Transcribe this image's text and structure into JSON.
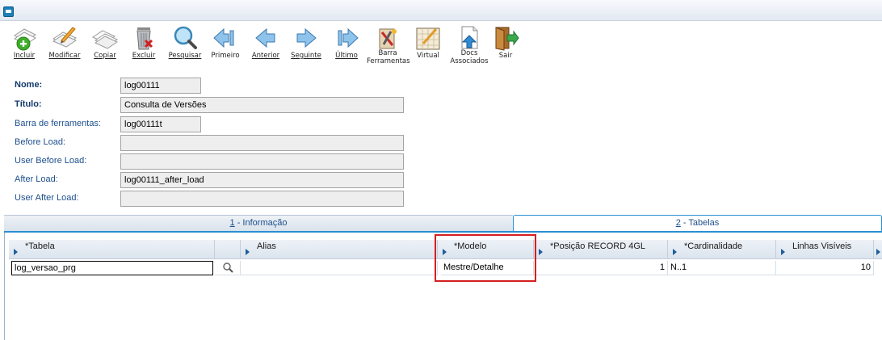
{
  "toolbar": {
    "items": [
      {
        "label": "Incluir",
        "icon": "add-document-icon"
      },
      {
        "label": "Modificar",
        "icon": "edit-document-icon"
      },
      {
        "label": "Copiar",
        "icon": "copy-document-icon"
      },
      {
        "label": "Excluir",
        "icon": "trash-delete-icon"
      },
      {
        "label": "Pesquisar",
        "icon": "magnifier-search-icon"
      },
      {
        "label": "Primeiro",
        "icon": "first-record-icon"
      },
      {
        "label": "Anterior",
        "icon": "previous-record-icon"
      },
      {
        "label": "Seguinte",
        "icon": "next-record-icon"
      },
      {
        "label": "Último",
        "icon": "last-record-icon"
      },
      {
        "label_line1": "Barra",
        "label_line2": "Ferramentas",
        "icon": "toolbar-tools-icon"
      },
      {
        "label": "Virtual",
        "icon": "virtual-grid-icon"
      },
      {
        "label_line1": "Docs",
        "label_line2": "Associados",
        "icon": "associated-docs-icon"
      },
      {
        "label": "Sair",
        "icon": "exit-door-icon"
      }
    ]
  },
  "form": {
    "nome": {
      "label": "Nome:",
      "value": "log00111"
    },
    "titulo": {
      "label": "Título:",
      "value": "Consulta de Versões"
    },
    "barra": {
      "label": "Barra de ferramentas:",
      "value": "log00111t"
    },
    "before_load": {
      "label": "Before Load:",
      "value": ""
    },
    "user_before_load": {
      "label": "User Before Load:",
      "value": ""
    },
    "after_load": {
      "label": "After Load:",
      "value": "log00111_after_load"
    },
    "user_after_load": {
      "label": "User After Load:",
      "value": ""
    }
  },
  "tabs": [
    {
      "key": "1",
      "label": " - Informação"
    },
    {
      "key": "2",
      "label": " - Tabelas"
    }
  ],
  "grid": {
    "columns": [
      "*Tabela",
      "Alias",
      "*Modelo",
      "*Posição RECORD 4GL",
      "*Cardinalidade",
      "Linhas Visíveis"
    ],
    "rows": [
      {
        "tabela": "log_versao_prg",
        "alias": "",
        "modelo": "Mestre/Detalhe",
        "posicao": "1",
        "cardinalidade": "N..1",
        "linhas": "10"
      }
    ]
  },
  "colors": {
    "accent": "#2a8fd3",
    "label": "#1d4f8c",
    "highlight": "#d42020"
  }
}
